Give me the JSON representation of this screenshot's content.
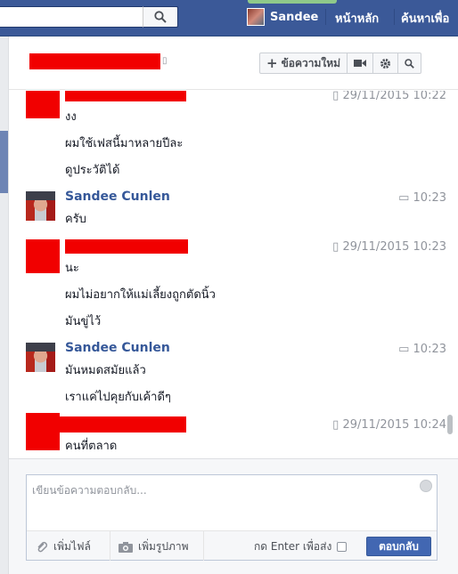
{
  "topbar": {
    "search": {
      "value": "",
      "icon": "search-icon"
    },
    "profile_name": "Sandee",
    "nav_home": "หน้าหลัก",
    "nav_find_friends": "ค้นหาเพื่อ"
  },
  "chat_header": {
    "new_message_label": "ข้อความใหม่",
    "icons": [
      "plus-icon",
      "video-call-icon",
      "gear-icon",
      "search-icon"
    ]
  },
  "messages": [
    {
      "author": "",
      "redacted": true,
      "time": "29/11/2015 10:22",
      "time_icon": "mobile-icon",
      "lines": [
        "งง",
        "ผมใช้เฟสนี้มาหลายปีละ",
        "ดูประวัติได้"
      ]
    },
    {
      "author": "Sandee Cunlen",
      "redacted": false,
      "time": "10:23",
      "time_icon": "chat-icon",
      "lines": [
        "ครับ"
      ]
    },
    {
      "author": "",
      "redacted": true,
      "time": "29/11/2015 10:23",
      "time_icon": "mobile-icon",
      "lines": [
        "นะ",
        "ผมไม่อยากให้แม่เลี้ยงถูกตัดนิ้ว",
        "มันขู่ไว้"
      ]
    },
    {
      "author": "Sandee Cunlen",
      "redacted": false,
      "time": "10:23",
      "time_icon": "chat-icon",
      "lines": [
        "มันหมดสมัยแล้ว",
        "เราแค่ไปคุยกับเค้าดีๆ"
      ]
    },
    {
      "author": "",
      "redacted": true,
      "time": "29/11/2015 10:24",
      "time_icon": "mobile-icon",
      "lines": [
        "คนที่ตลาด"
      ]
    }
  ],
  "composer": {
    "placeholder": "เขียนข้อความตอบกลับ...",
    "add_file": "เพิ่มไฟล์",
    "add_photo": "เพิ่มรูปภาพ",
    "enter_to_send": "กด Enter เพื่อส่ง",
    "reply_button": "ตอบกลับ"
  },
  "colors": {
    "brand_blue": "#3b5998",
    "link_blue": "#365899",
    "redaction_red": "#f10000"
  }
}
